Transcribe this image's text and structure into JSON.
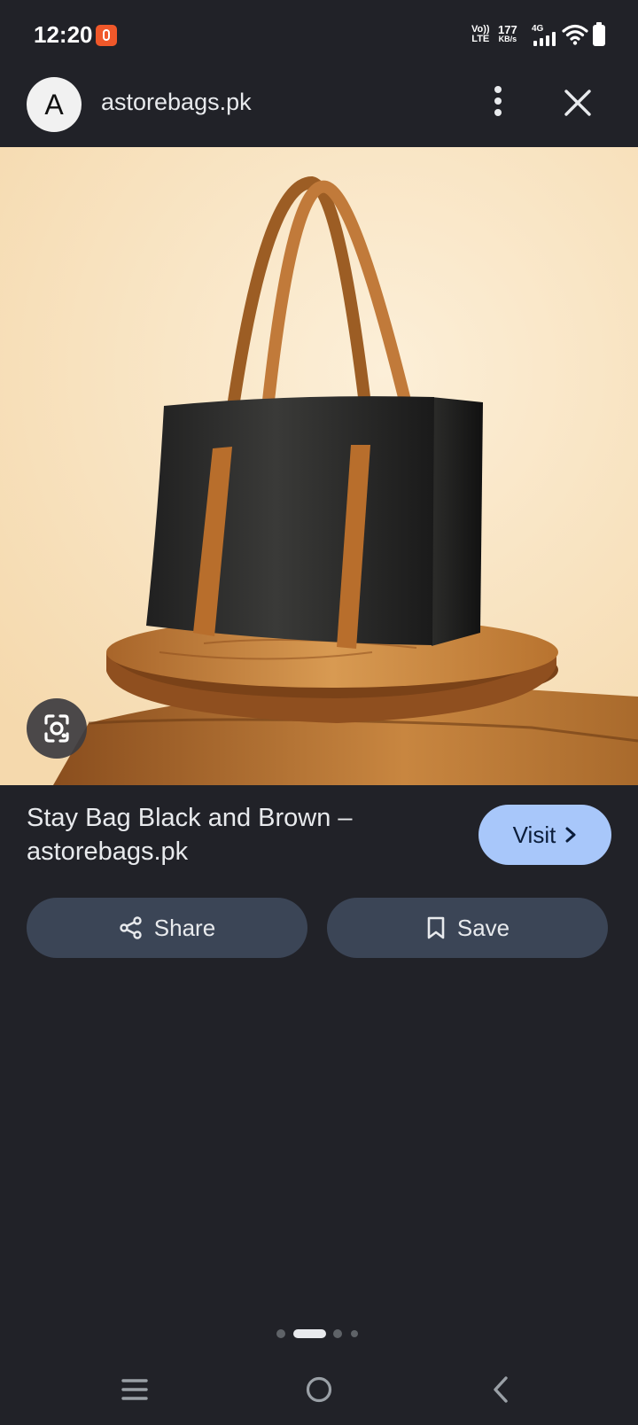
{
  "status_bar": {
    "time": "12:20",
    "volte_line1": "Vo))",
    "volte_line2": "LTE",
    "speed_value": "177",
    "speed_unit": "KB/s",
    "network": "4G"
  },
  "header": {
    "site_initial": "A",
    "site_name": "astorebags.pk"
  },
  "result": {
    "title": "Stay Bag Black and Brown – astorebags.pk",
    "visit_label": "Visit",
    "share_label": "Share",
    "save_label": "Save"
  },
  "pager": {
    "count": 4,
    "active_index": 1
  },
  "icons": {
    "notification": "app-notification-icon",
    "signal": "signal-icon",
    "wifi": "wifi-icon",
    "battery": "battery-icon",
    "more": "more-vert-icon",
    "close": "close-icon",
    "lens": "google-lens-icon",
    "share": "share-icon",
    "save": "bookmark-icon",
    "chevron": "chevron-right-icon",
    "nav_menu": "recents-icon",
    "nav_home": "home-icon",
    "nav_back": "back-icon"
  },
  "colors": {
    "background": "#212228",
    "visit_button": "#a8c7fa",
    "pill_button": "#3b4556",
    "image_background": "#f8e4c6"
  }
}
